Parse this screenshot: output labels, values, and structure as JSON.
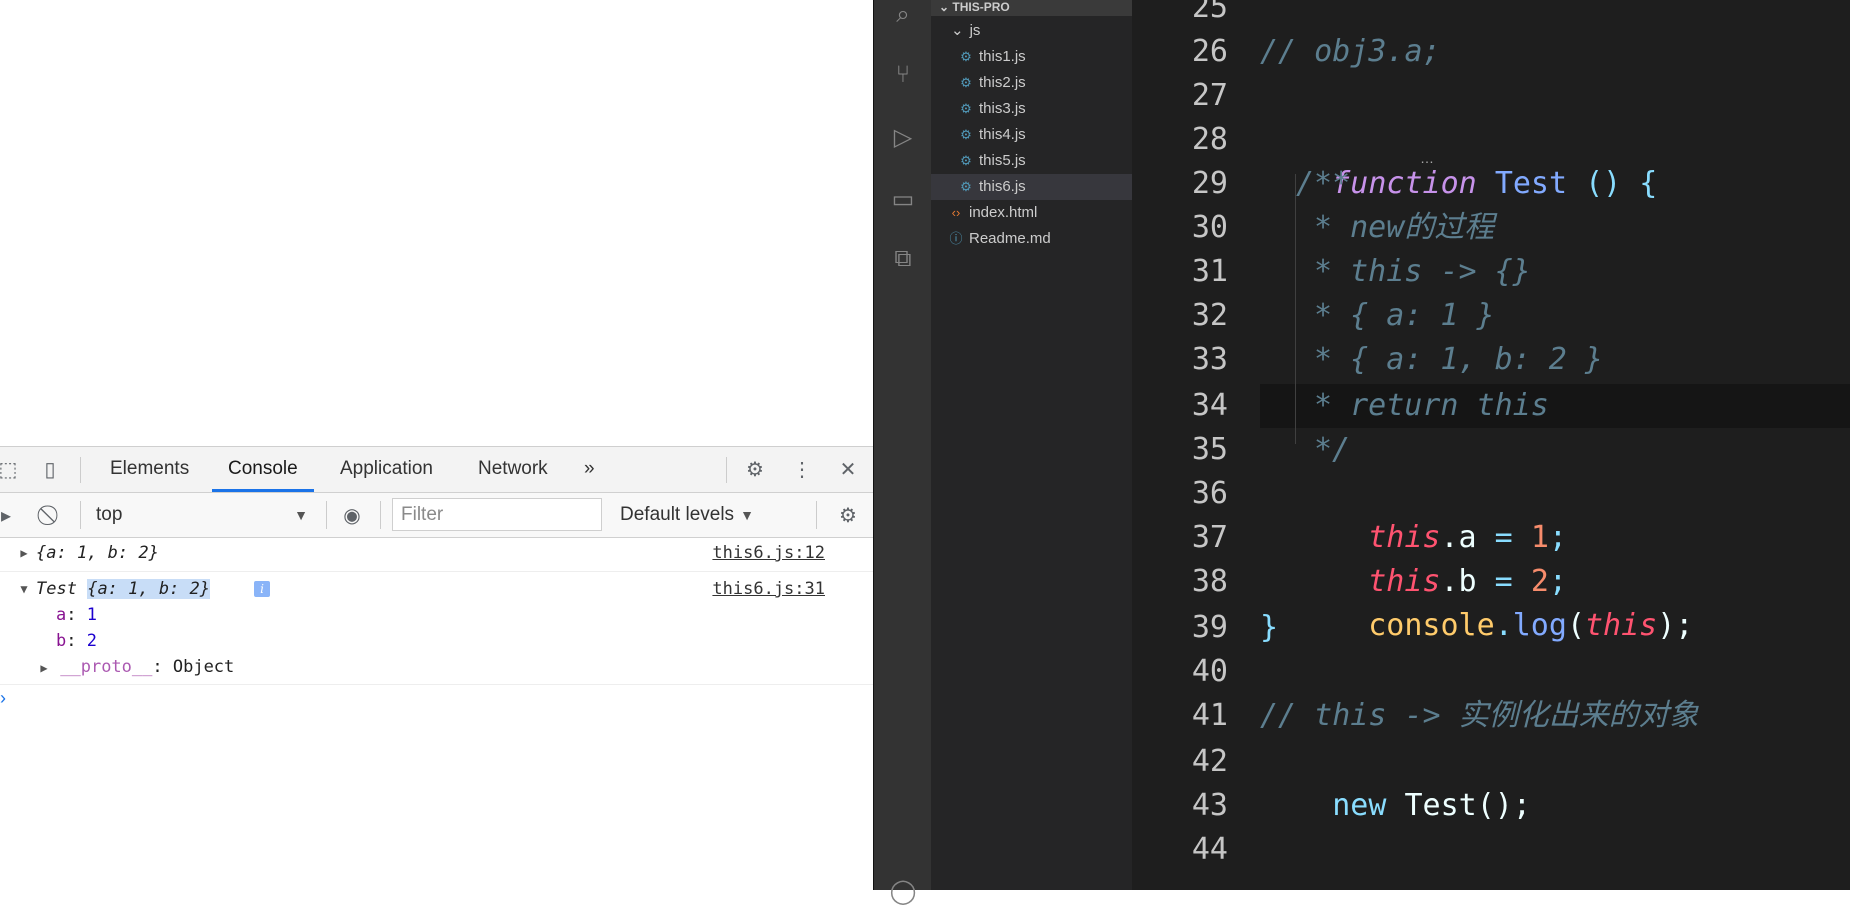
{
  "devtools": {
    "tabs": [
      "Elements",
      "Console",
      "Application",
      "Network"
    ],
    "more_tabs": "»",
    "context": "top",
    "filter_placeholder": "Filter",
    "levels": "Default levels"
  },
  "console": {
    "row1": {
      "preview": "{a: 1, b: 2}",
      "source": "this6.js:12"
    },
    "row2": {
      "class_name": "Test",
      "preview": "{a: 1, b: 2}",
      "source": "this6.js:31",
      "props": [
        {
          "key": "a",
          "value": "1"
        },
        {
          "key": "b",
          "value": "2"
        }
      ],
      "proto_key": "__proto__",
      "proto_value": "Object",
      "info_badge": "i"
    },
    "prompt": "›"
  },
  "vscode": {
    "explorer_title": "THIS-PRO",
    "folder": "js",
    "files": [
      {
        "name": "this1.js",
        "type": "js"
      },
      {
        "name": "this2.js",
        "type": "js"
      },
      {
        "name": "this3.js",
        "type": "js"
      },
      {
        "name": "this4.js",
        "type": "js"
      },
      {
        "name": "this5.js",
        "type": "js"
      },
      {
        "name": "this6.js",
        "type": "js",
        "selected": true
      }
    ],
    "root_files": [
      {
        "name": "index.html",
        "type": "html"
      },
      {
        "name": "Readme.md",
        "type": "md"
      }
    ],
    "line_numbers": [
      "25",
      "26",
      "27",
      "28",
      "29",
      "30",
      "31",
      "32",
      "33",
      "34",
      "35",
      "36",
      "37",
      "38",
      "39",
      "40",
      "41",
      "42",
      "43",
      "44"
    ],
    "code": {
      "l26": "// obj3.a;",
      "l28_kw": "function",
      "l28_name": "Test",
      "l28_rest": " () {",
      "l29": "/**",
      "l30": "* new的过程",
      "l31": "* this -> {}",
      "l32": "* { a: 1 }",
      "l33": "* { a: 1, b: 2 }",
      "l34": "* return this",
      "l35": "*/",
      "l36_this": "this",
      "l36_prop": ".a",
      "l36_op": " = ",
      "l36_num": "1",
      "l36_end": ";",
      "l37_this": "this",
      "l37_prop": ".b",
      "l37_op": " = ",
      "l37_num": "2",
      "l37_end": ";",
      "l38_console": "console",
      "l38_dot": ".",
      "l38_log": "log",
      "l38_open": "(",
      "l38_this": "this",
      "l38_close": ");",
      "l39": "}",
      "l41": "// this -> 实例化出来的对象",
      "l42_new": "new",
      "l42_rest": " Test();"
    }
  }
}
